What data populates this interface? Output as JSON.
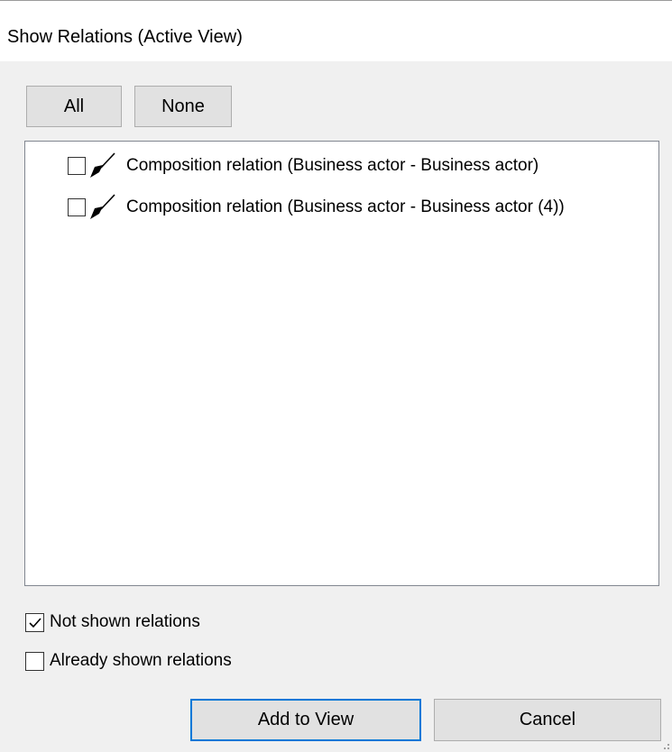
{
  "window": {
    "title": "Show Relations (Active View)"
  },
  "toolbar": {
    "all_label": "All",
    "none_label": "None"
  },
  "relations": {
    "items": [
      {
        "label": "Composition relation (Business actor - Business actor)",
        "checked": false,
        "icon": "composition-relation-icon"
      },
      {
        "label": "Composition relation (Business actor - Business actor (4))",
        "checked": false,
        "icon": "composition-relation-icon"
      }
    ]
  },
  "filters": {
    "not_shown_label": "Not shown relations",
    "not_shown_checked": true,
    "already_shown_label": "Already shown relations",
    "already_shown_checked": false
  },
  "footer": {
    "add_label": "Add to View",
    "cancel_label": "Cancel"
  },
  "colors": {
    "focus_border": "#0078d7",
    "button_face": "#e1e1e1",
    "dialog_bg": "#f0f0f0"
  }
}
